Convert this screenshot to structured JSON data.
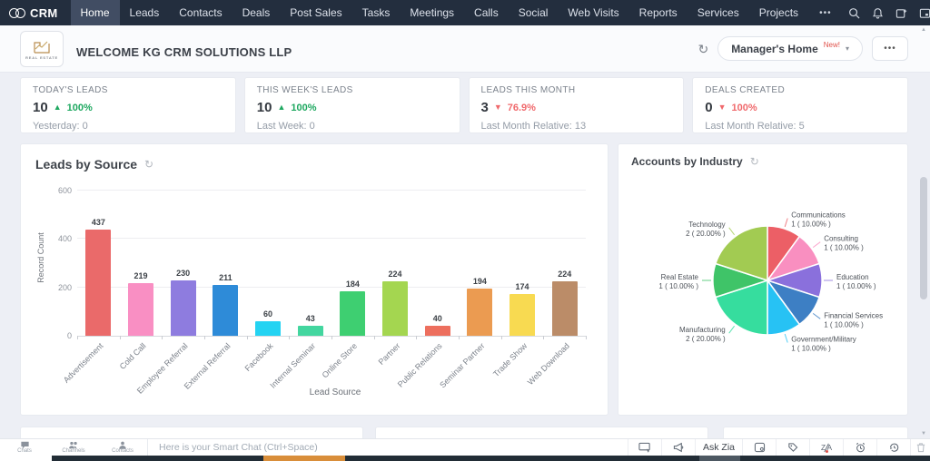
{
  "nav": {
    "brand": "CRM",
    "items": [
      {
        "label": "Home",
        "active": true
      },
      {
        "label": "Leads",
        "active": false
      },
      {
        "label": "Contacts",
        "active": false
      },
      {
        "label": "Deals",
        "active": false
      },
      {
        "label": "Post Sales",
        "active": false
      },
      {
        "label": "Tasks",
        "active": false
      },
      {
        "label": "Meetings",
        "active": false
      },
      {
        "label": "Calls",
        "active": false
      },
      {
        "label": "Social",
        "active": false
      },
      {
        "label": "Web Visits",
        "active": false
      },
      {
        "label": "Reports",
        "active": false
      },
      {
        "label": "Services",
        "active": false
      },
      {
        "label": "Projects",
        "active": false
      }
    ],
    "more_label": "•••"
  },
  "header": {
    "title": "WELCOME KG CRM SOLUTIONS LLP",
    "logo_text": "REAL ESTATE",
    "dashboard_selector": "Manager's Home",
    "new_badge": "New!",
    "more_label": "•••"
  },
  "kpis": [
    {
      "title": "TODAY'S LEADS",
      "value": "10",
      "trend": "up",
      "percent": "100%",
      "sub": "Yesterday: 0"
    },
    {
      "title": "THIS WEEK'S LEADS",
      "value": "10",
      "trend": "up",
      "percent": "100%",
      "sub": "Last Week: 0"
    },
    {
      "title": "LEADS THIS MONTH",
      "value": "3",
      "trend": "down",
      "percent": "76.9%",
      "sub": "Last Month Relative: 13"
    },
    {
      "title": "DEALS CREATED",
      "value": "0",
      "trend": "down",
      "percent": "100%",
      "sub": "Last Month Relative: 5"
    }
  ],
  "chart_data": [
    {
      "type": "bar",
      "title": "Leads by Source",
      "xlabel": "Lead Source",
      "ylabel": "Record Count",
      "ylim": [
        0,
        600
      ],
      "yticks": [
        0,
        200,
        400,
        600
      ],
      "categories": [
        "Advertisement",
        "Cold Call",
        "Employee Referral",
        "External Referral",
        "Facebook",
        "Internal Seminar",
        "Online Store",
        "Partner",
        "Public Relations",
        "Seminar Partner",
        "Trade Show",
        "Web Download"
      ],
      "values": [
        437,
        219,
        230,
        211,
        60,
        43,
        184,
        224,
        40,
        194,
        174,
        224
      ],
      "colors": [
        "#ea6a6a",
        "#f98fc3",
        "#8e7cdf",
        "#2e8bd8",
        "#24d3f2",
        "#43d69f",
        "#3ecf71",
        "#a4d650",
        "#ed6f5e",
        "#eb9b51",
        "#f8da51",
        "#bb8c68"
      ]
    },
    {
      "type": "pie",
      "title": "Accounts by Industry",
      "slices": [
        {
          "label": "Communications",
          "value": 1,
          "percent": "10.00%",
          "color": "#ec5f66"
        },
        {
          "label": "Consulting",
          "value": 1,
          "percent": "10.00%",
          "color": "#f98fc0"
        },
        {
          "label": "Education",
          "value": 1,
          "percent": "10.00%",
          "color": "#8a70dc"
        },
        {
          "label": "Financial Services",
          "value": 1,
          "percent": "10.00%",
          "color": "#3d7fc4"
        },
        {
          "label": "Government/Military",
          "value": 1,
          "percent": "10.00%",
          "color": "#27c2f4"
        },
        {
          "label": "Manufacturing",
          "value": 2,
          "percent": "20.00%",
          "color": "#36dd9e"
        },
        {
          "label": "Real Estate",
          "value": 1,
          "percent": "10.00%",
          "color": "#3fc468"
        },
        {
          "label": "Technology",
          "value": 2,
          "percent": "20.00%",
          "color": "#a2cb52"
        }
      ]
    }
  ],
  "chat_bar": {
    "tabs": [
      {
        "label": "Chats"
      },
      {
        "label": "Channels"
      },
      {
        "label": "Contacts"
      }
    ],
    "placeholder": "Here is your Smart Chat (Ctrl+Space)",
    "ask_zia": "Ask Zia"
  }
}
